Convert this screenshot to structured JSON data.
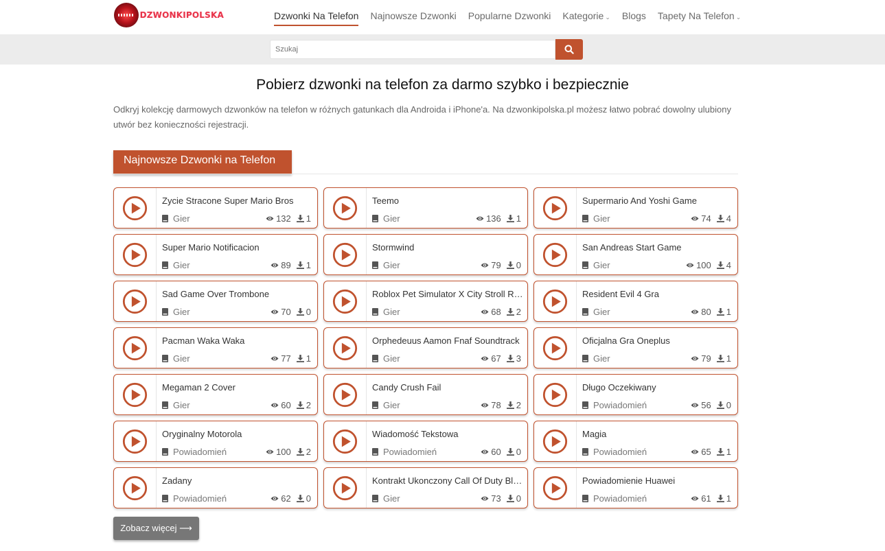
{
  "brand": {
    "logo_text": "DZWONKIPOLSKA"
  },
  "nav": {
    "items": [
      {
        "label": "Dzwonki Na Telefon",
        "active": true,
        "dropdown": false
      },
      {
        "label": "Najnowsze Dzwonki",
        "active": false,
        "dropdown": false
      },
      {
        "label": "Popularne Dzwonki",
        "active": false,
        "dropdown": false
      },
      {
        "label": "Kategorie",
        "active": false,
        "dropdown": true
      },
      {
        "label": "Blogs",
        "active": false,
        "dropdown": false
      },
      {
        "label": "Tapety Na Telefon",
        "active": false,
        "dropdown": true
      }
    ]
  },
  "search": {
    "placeholder": "Szukaj",
    "value": "",
    "button_icon": "search-icon"
  },
  "page": {
    "title": "Pobierz dzwonki na telefon za darmo szybko i bezpiecznie",
    "intro": "Odkryj kolekcję darmowych dzwonków na telefon w różnych gatunkach dla Androida i iPhone'a. Na dzwonkipolska.pl możesz łatwo pobrać dowolny ulubiony utwór bez konieczności rejestracji."
  },
  "section": {
    "title": "Najnowsze Dzwonki na Telefon",
    "more_label": "Zobacz więcej ⟶"
  },
  "colors": {
    "accent": "#c0522e",
    "more_button": "#777777",
    "search_band": "#ececec"
  },
  "ringtones": [
    {
      "title": "Zycie Stracone Super Mario Bros",
      "category": "Gier",
      "views": "132",
      "downloads": "1"
    },
    {
      "title": "Teemo",
      "category": "Gier",
      "views": "136",
      "downloads": "1"
    },
    {
      "title": "Supermario And Yoshi Game",
      "category": "Gier",
      "views": "74",
      "downloads": "4"
    },
    {
      "title": "Super Mario Notificacion",
      "category": "Gier",
      "views": "89",
      "downloads": "1"
    },
    {
      "title": "Stormwind",
      "category": "Gier",
      "views": "79",
      "downloads": "0"
    },
    {
      "title": "San Andreas Start Game",
      "category": "Gier",
      "views": "100",
      "downloads": "4"
    },
    {
      "title": "Sad Game Over Trombone",
      "category": "Gier",
      "views": "70",
      "downloads": "0"
    },
    {
      "title": "Roblox Pet Simulator X City Stroll Robl...",
      "category": "Gier",
      "views": "68",
      "downloads": "2"
    },
    {
      "title": "Resident Evil 4 Gra",
      "category": "Gier",
      "views": "80",
      "downloads": "1"
    },
    {
      "title": "Pacman Waka Waka",
      "category": "Gier",
      "views": "77",
      "downloads": "1"
    },
    {
      "title": "Orphedeuus Aamon Fnaf Soundtrack",
      "category": "Gier",
      "views": "67",
      "downloads": "3"
    },
    {
      "title": "Oficjalna Gra Oneplus",
      "category": "Gier",
      "views": "79",
      "downloads": "1"
    },
    {
      "title": "Megaman 2 Cover",
      "category": "Gier",
      "views": "60",
      "downloads": "2"
    },
    {
      "title": "Candy Crush Fail",
      "category": "Gier",
      "views": "78",
      "downloads": "2"
    },
    {
      "title": "Długo Oczekiwany",
      "category": "Powiadomień",
      "views": "56",
      "downloads": "0"
    },
    {
      "title": "Oryginalny Motorola",
      "category": "Powiadomień",
      "views": "100",
      "downloads": "2"
    },
    {
      "title": "Wiadomość Tekstowa",
      "category": "Powiadomień",
      "views": "60",
      "downloads": "0"
    },
    {
      "title": "Magia",
      "category": "Powiadomień",
      "views": "65",
      "downloads": "1"
    },
    {
      "title": "Zadany",
      "category": "Powiadomień",
      "views": "62",
      "downloads": "0"
    },
    {
      "title": "Kontrakt Ukonczony Call Of Duty Blac...",
      "category": "Gier",
      "views": "73",
      "downloads": "0"
    },
    {
      "title": "Powiadomienie Huawei",
      "category": "Powiadomień",
      "views": "61",
      "downloads": "1"
    }
  ]
}
